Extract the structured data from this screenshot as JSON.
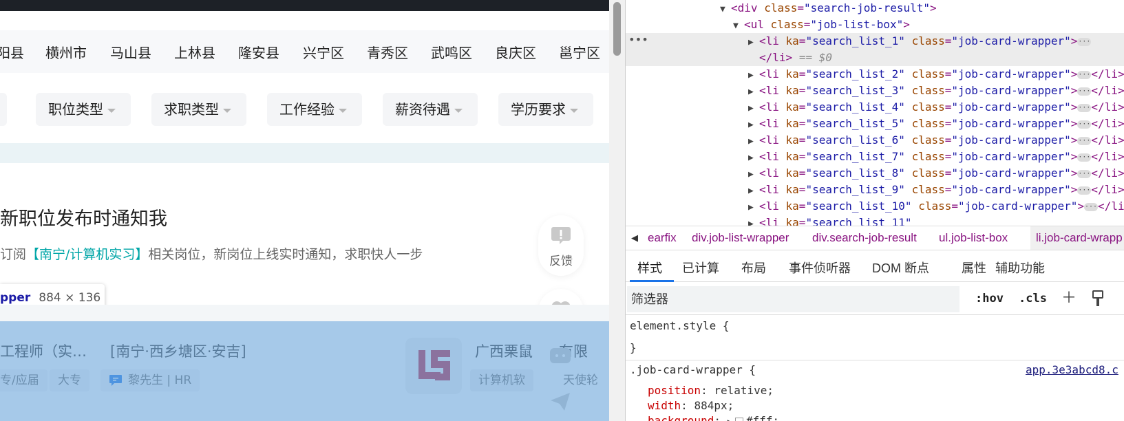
{
  "districts": [
    "阳县",
    "横州市",
    "马山县",
    "上林县",
    "隆安县",
    "兴宁区",
    "青秀区",
    "武鸣区",
    "良庆区",
    "邕宁区"
  ],
  "filters": [
    "职位类型",
    "求职类型",
    "工作经验",
    "薪资待遇",
    "学历要求"
  ],
  "notify": {
    "title": "新职位发布时通知我",
    "desc_prefix": "订阅",
    "desc_highlight": "【南宁/计算机实习】",
    "desc_suffix": "相关岗位，新岗位上线实时通知，求职快人一步"
  },
  "float_feedback_label": "反馈",
  "tooltip": {
    "name": "pper",
    "size": "884 × 136"
  },
  "job_card": {
    "title": "工程师（实…",
    "area": "[南宁·西乡塘区·安吉]",
    "tags": [
      "专/应届",
      "大专"
    ],
    "hr": "黎先生 | HR",
    "company": "广西栗鼠",
    "company_suffix": "有限",
    "industry": "计算机软",
    "company_tag": "天使轮"
  },
  "dom": {
    "line1": {
      "tag": "div",
      "attr": "class",
      "val": "\"search-job-result\""
    },
    "line2": {
      "tag": "ul",
      "attr": "class",
      "val": "\"job-list-box\""
    },
    "selected": {
      "ka": "\"search_list_1\"",
      "class": "\"job-card-wrapper\""
    },
    "closing": "</li>",
    "eq": "== $0",
    "items": [
      "\"search_list_2\"",
      "\"search_list_3\"",
      "\"search_list_4\"",
      "\"search_list_5\"",
      "\"search_list_6\"",
      "\"search_list_7\"",
      "\"search_list_8\"",
      "\"search_list_9\"",
      "\"search_list_10\""
    ],
    "item_class": "\"job-card-wrapper\""
  },
  "breadcrumbs": [
    "earfix",
    "div.job-list-wrapper",
    "div.search-job-result",
    "ul.job-list-box",
    "li.job-card-wrapp"
  ],
  "panel_tabs": [
    "样式",
    "已计算",
    "布局",
    "事件侦听器",
    "DOM 断点",
    "属性",
    "辅助功能"
  ],
  "filter_placeholder": "筛选器",
  "tools": {
    "hov": ":hov",
    "cls": ".cls"
  },
  "styles": {
    "element_style": "element.style {",
    "close_brace": "}",
    "selector": ".job-card-wrapper {",
    "source": "app.3e3abcd8.c",
    "props": [
      {
        "name": "position",
        "value": "relative;"
      },
      {
        "name": "width",
        "value": "884px;"
      },
      {
        "name": "background",
        "value": "#fff;"
      }
    ]
  },
  "colors": {
    "highlight": "#00a6a7",
    "overlay": "#6fa8dc",
    "tag": "#881280",
    "attr": "#994500",
    "value": "#1a1aa6"
  }
}
